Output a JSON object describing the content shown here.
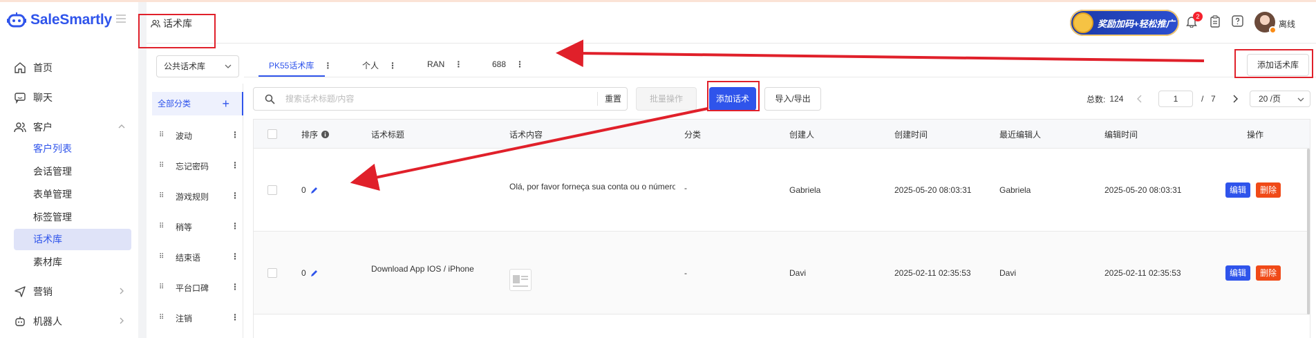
{
  "app": {
    "logo_text": "SaleSmartly"
  },
  "sidebar": {
    "items": [
      {
        "label": "首页",
        "icon": "home-icon"
      },
      {
        "label": "聊天",
        "icon": "chat-icon"
      },
      {
        "label": "客户",
        "icon": "users-icon"
      },
      {
        "label": "营销",
        "icon": "send-icon"
      },
      {
        "label": "机器人",
        "icon": "robot-icon"
      }
    ],
    "sub_items": [
      "客户列表",
      "会话管理",
      "表单管理",
      "标签管理",
      "话术库",
      "素材库"
    ]
  },
  "header": {
    "page_tab": "话术库",
    "promo_text": "奖励加码+轻松推广",
    "notification_count": "2",
    "status": "离线"
  },
  "library": {
    "selected": "公共话术库",
    "tabs": [
      "PK55话术库",
      "个人",
      "RAN",
      "688"
    ],
    "add_button": "添加话术库"
  },
  "categories": {
    "all_label": "全部分类",
    "items": [
      "波动",
      "忘记密码",
      "游戏规则",
      "稍等",
      "结束语",
      "平台口碑",
      "注销"
    ]
  },
  "toolbar": {
    "search_placeholder": "搜索话术标题/内容",
    "reset": "重置",
    "batch": "批量操作",
    "add": "添加话术",
    "import_export": "导入/导出"
  },
  "pagination": {
    "total_label": "总数:",
    "total": "124",
    "current": "1",
    "separator": "/",
    "pages": "7",
    "page_size": "20 /页"
  },
  "table": {
    "headers": [
      "排序",
      "话术标题",
      "话术内容",
      "分类",
      "创建人",
      "创建时间",
      "最近编辑人",
      "编辑时间",
      "操作"
    ],
    "rows": [
      {
        "order": "0",
        "title": "--",
        "content": "Olá, por favor forneça sua conta ou o número",
        "category": "-",
        "creator": "Gabriela",
        "created_at": "2025-05-20 08:03:31",
        "editor": "Gabriela",
        "edited_at": "2025-05-20 08:03:31"
      },
      {
        "order": "0",
        "title": "Download App IOS / iPhone",
        "content": "",
        "category": "-",
        "creator": "Davi",
        "created_at": "2025-02-11 02:35:53",
        "editor": "Davi",
        "edited_at": "2025-02-11 02:35:53"
      }
    ],
    "edit_label": "编辑",
    "delete_label": "删除"
  },
  "colors": {
    "primary": "#2f54eb",
    "danger": "#f04a18",
    "annotation": "#e0202a"
  }
}
